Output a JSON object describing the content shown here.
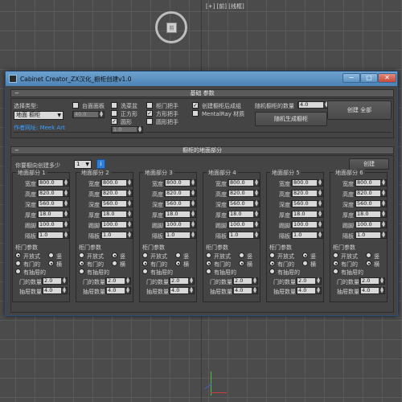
{
  "viewport": {
    "label": "[+] [前] [线框]",
    "viewcube_face": "前"
  },
  "window": {
    "title": "Cabinet Creator_ZX汉化_橱柜创建v1.0",
    "minimize": "−",
    "maximize": "□",
    "close": "✕"
  },
  "basic": {
    "header": "基础 参数",
    "collapse_sign": "−",
    "type_label": "选择类型:",
    "type_value": "地面 橱柜",
    "link_text": "作者网址: Meek Art",
    "top_panel_label": "台面面板",
    "top_panel_value": "40.0",
    "sink_label": "洗菜盆",
    "square_label": "正方形",
    "round_label": "圆形",
    "round_value": "1.0",
    "door_handle_label": "柜门把手",
    "square_handle_label": "方形把手",
    "round_handle_label": "圆形把手",
    "group_after_label": "创建橱柜后成组",
    "mentalray_label": "MentalRay 材质",
    "random_count_label": "随机橱柜的数量",
    "random_count_value": "4.0",
    "random_button": "随机生成橱柜",
    "create_all_button": "创建 全部"
  },
  "floor": {
    "header": "橱柜的地面部分",
    "collapse_sign": "−",
    "how_many_label": "你要橱向创建多少",
    "count_value": "1",
    "info_icon": "i",
    "create_button": "创建",
    "section_prefix": "地面部分",
    "field_labels": [
      "宽度",
      "高度",
      "深度",
      "厚度",
      "踢脚",
      "隔板"
    ],
    "door_params_label": "柜门参数",
    "opt_open": "开放式",
    "opt_vertical": "竖",
    "opt_door": "有门的",
    "opt_horizontal": "横",
    "opt_drawer": "有抽屉的",
    "door_count_label": "门的数量",
    "drawer_count_label": "抽屉数量",
    "sections": [
      {
        "num": "1",
        "values": [
          "800.0",
          "820.0",
          "560.0",
          "18.0",
          "100.0",
          "1.0"
        ],
        "door_count": "2.0",
        "drawer_count": "4.0",
        "ops": [
          "1",
          "0",
          "0"
        ],
        "orient": "h"
      },
      {
        "num": "2",
        "values": [
          "800.0",
          "820.0",
          "560.0",
          "18.0",
          "100.0",
          "1.0"
        ],
        "door_count": "2.0",
        "drawer_count": "4.0",
        "ops": [
          "0",
          "1",
          "0"
        ],
        "orient": "v"
      },
      {
        "num": "3",
        "values": [
          "800.0",
          "820.0",
          "560.0",
          "18.0",
          "100.0",
          "1.0"
        ],
        "door_count": "2.0",
        "drawer_count": "4.0",
        "ops": [
          "0",
          "1",
          "0"
        ],
        "orient": "h"
      },
      {
        "num": "4",
        "values": [
          "800.0",
          "820.0",
          "560.0",
          "18.0",
          "100.0",
          "1.0"
        ],
        "door_count": "2.0",
        "drawer_count": "4.0",
        "ops": [
          "0",
          "1",
          "0"
        ],
        "orient": "h"
      },
      {
        "num": "5",
        "values": [
          "800.0",
          "820.0",
          "560.0",
          "18.0",
          "100.0",
          "1.0"
        ],
        "door_count": "2.0",
        "drawer_count": "4.0",
        "ops": [
          "0",
          "1",
          "0"
        ],
        "orient": "v"
      },
      {
        "num": "6",
        "values": [
          "800.0",
          "820.0",
          "560.0",
          "18.0",
          "100.0",
          "1.0"
        ],
        "door_count": "2.0",
        "drawer_count": "4.0",
        "ops": [
          "0",
          "1",
          "0"
        ],
        "orient": "h"
      }
    ]
  }
}
